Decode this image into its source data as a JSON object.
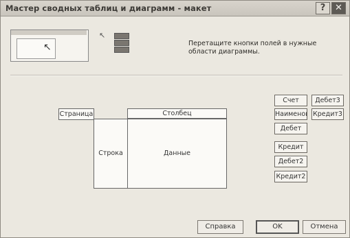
{
  "window": {
    "title": "Мастер сводных таблиц и диаграмм - макет",
    "help_glyph": "?",
    "close_glyph": "✕"
  },
  "instruction": "Перетащите кнопки полей в нужные области диаграммы.",
  "layout": {
    "page_label": "Страница",
    "column_label": "Столбец",
    "row_label": "Строка",
    "data_label": "Данные"
  },
  "fields": [
    "Счет",
    "Дебет3",
    "Наименов",
    "Кредит3",
    "Дебет",
    "Кредит",
    "Дебет2",
    "Кредит2"
  ],
  "buttons": {
    "help": "Справка",
    "ok": "OK",
    "cancel": "Отмена"
  },
  "colors": {
    "titlebar": "#c9c5bd",
    "dialog": "#ebe8e0",
    "close": "#5d5a55"
  }
}
